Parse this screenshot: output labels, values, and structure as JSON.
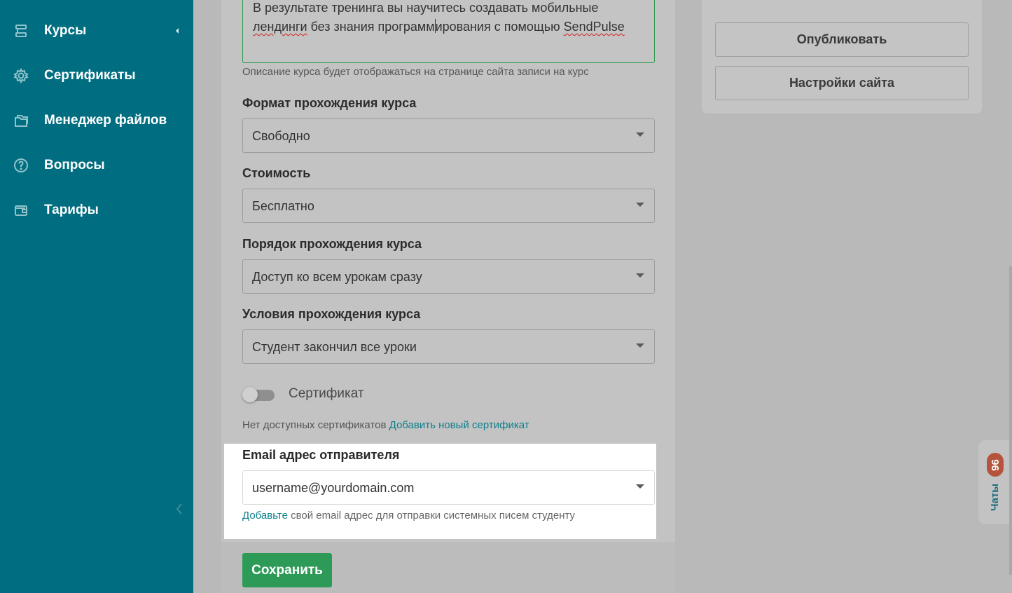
{
  "sidebar": {
    "items": [
      {
        "label": "Курсы",
        "icon": "courses-icon"
      },
      {
        "label": "Сертификаты",
        "icon": "gear-icon"
      },
      {
        "label": "Менеджер файлов",
        "icon": "files-icon"
      },
      {
        "label": "Вопросы",
        "icon": "question-icon"
      },
      {
        "label": "Тарифы",
        "icon": "wallet-icon"
      }
    ]
  },
  "form": {
    "description_line1": "В результате тренинга вы научитесь создавать мобильные",
    "description_line2_a": "лендинги",
    "description_line2_b": " без знания программ",
    "description_line2_c": "ирования с помощью ",
    "description_line2_d": "SendPulse",
    "description_hint": "Описание курса будет отображаться на странице сайта записи на курс",
    "format_label": "Формат прохождения курса",
    "format_value": "Свободно",
    "price_label": "Стоимость",
    "price_value": "Бесплатно",
    "order_label": "Порядок прохождения курса",
    "order_value": "Доступ ко всем урокам сразу",
    "conditions_label": "Условия прохождения курса",
    "conditions_value": "Студент закончил все уроки",
    "certificate_label": "Сертификат",
    "certificate_hint": "Нет доступных сертификатов ",
    "certificate_link": "Добавить новый сертификат",
    "email_label": "Email адрес отправителя",
    "email_value": "username@yourdomain.com",
    "email_hint_link": "Добавьте",
    "email_hint_text": " свой email адрес для отправки системных писем студенту",
    "save_label": "Сохранить"
  },
  "right_panel": {
    "publish_label": "Опубликовать",
    "site_settings_label": "Настройки сайта"
  },
  "chat": {
    "count": "96",
    "label": "Чаты"
  },
  "colors": {
    "sidebar": "#006e80",
    "accent_green": "#2e9a58",
    "link": "#0d7f8c",
    "badge": "#b5543d"
  }
}
